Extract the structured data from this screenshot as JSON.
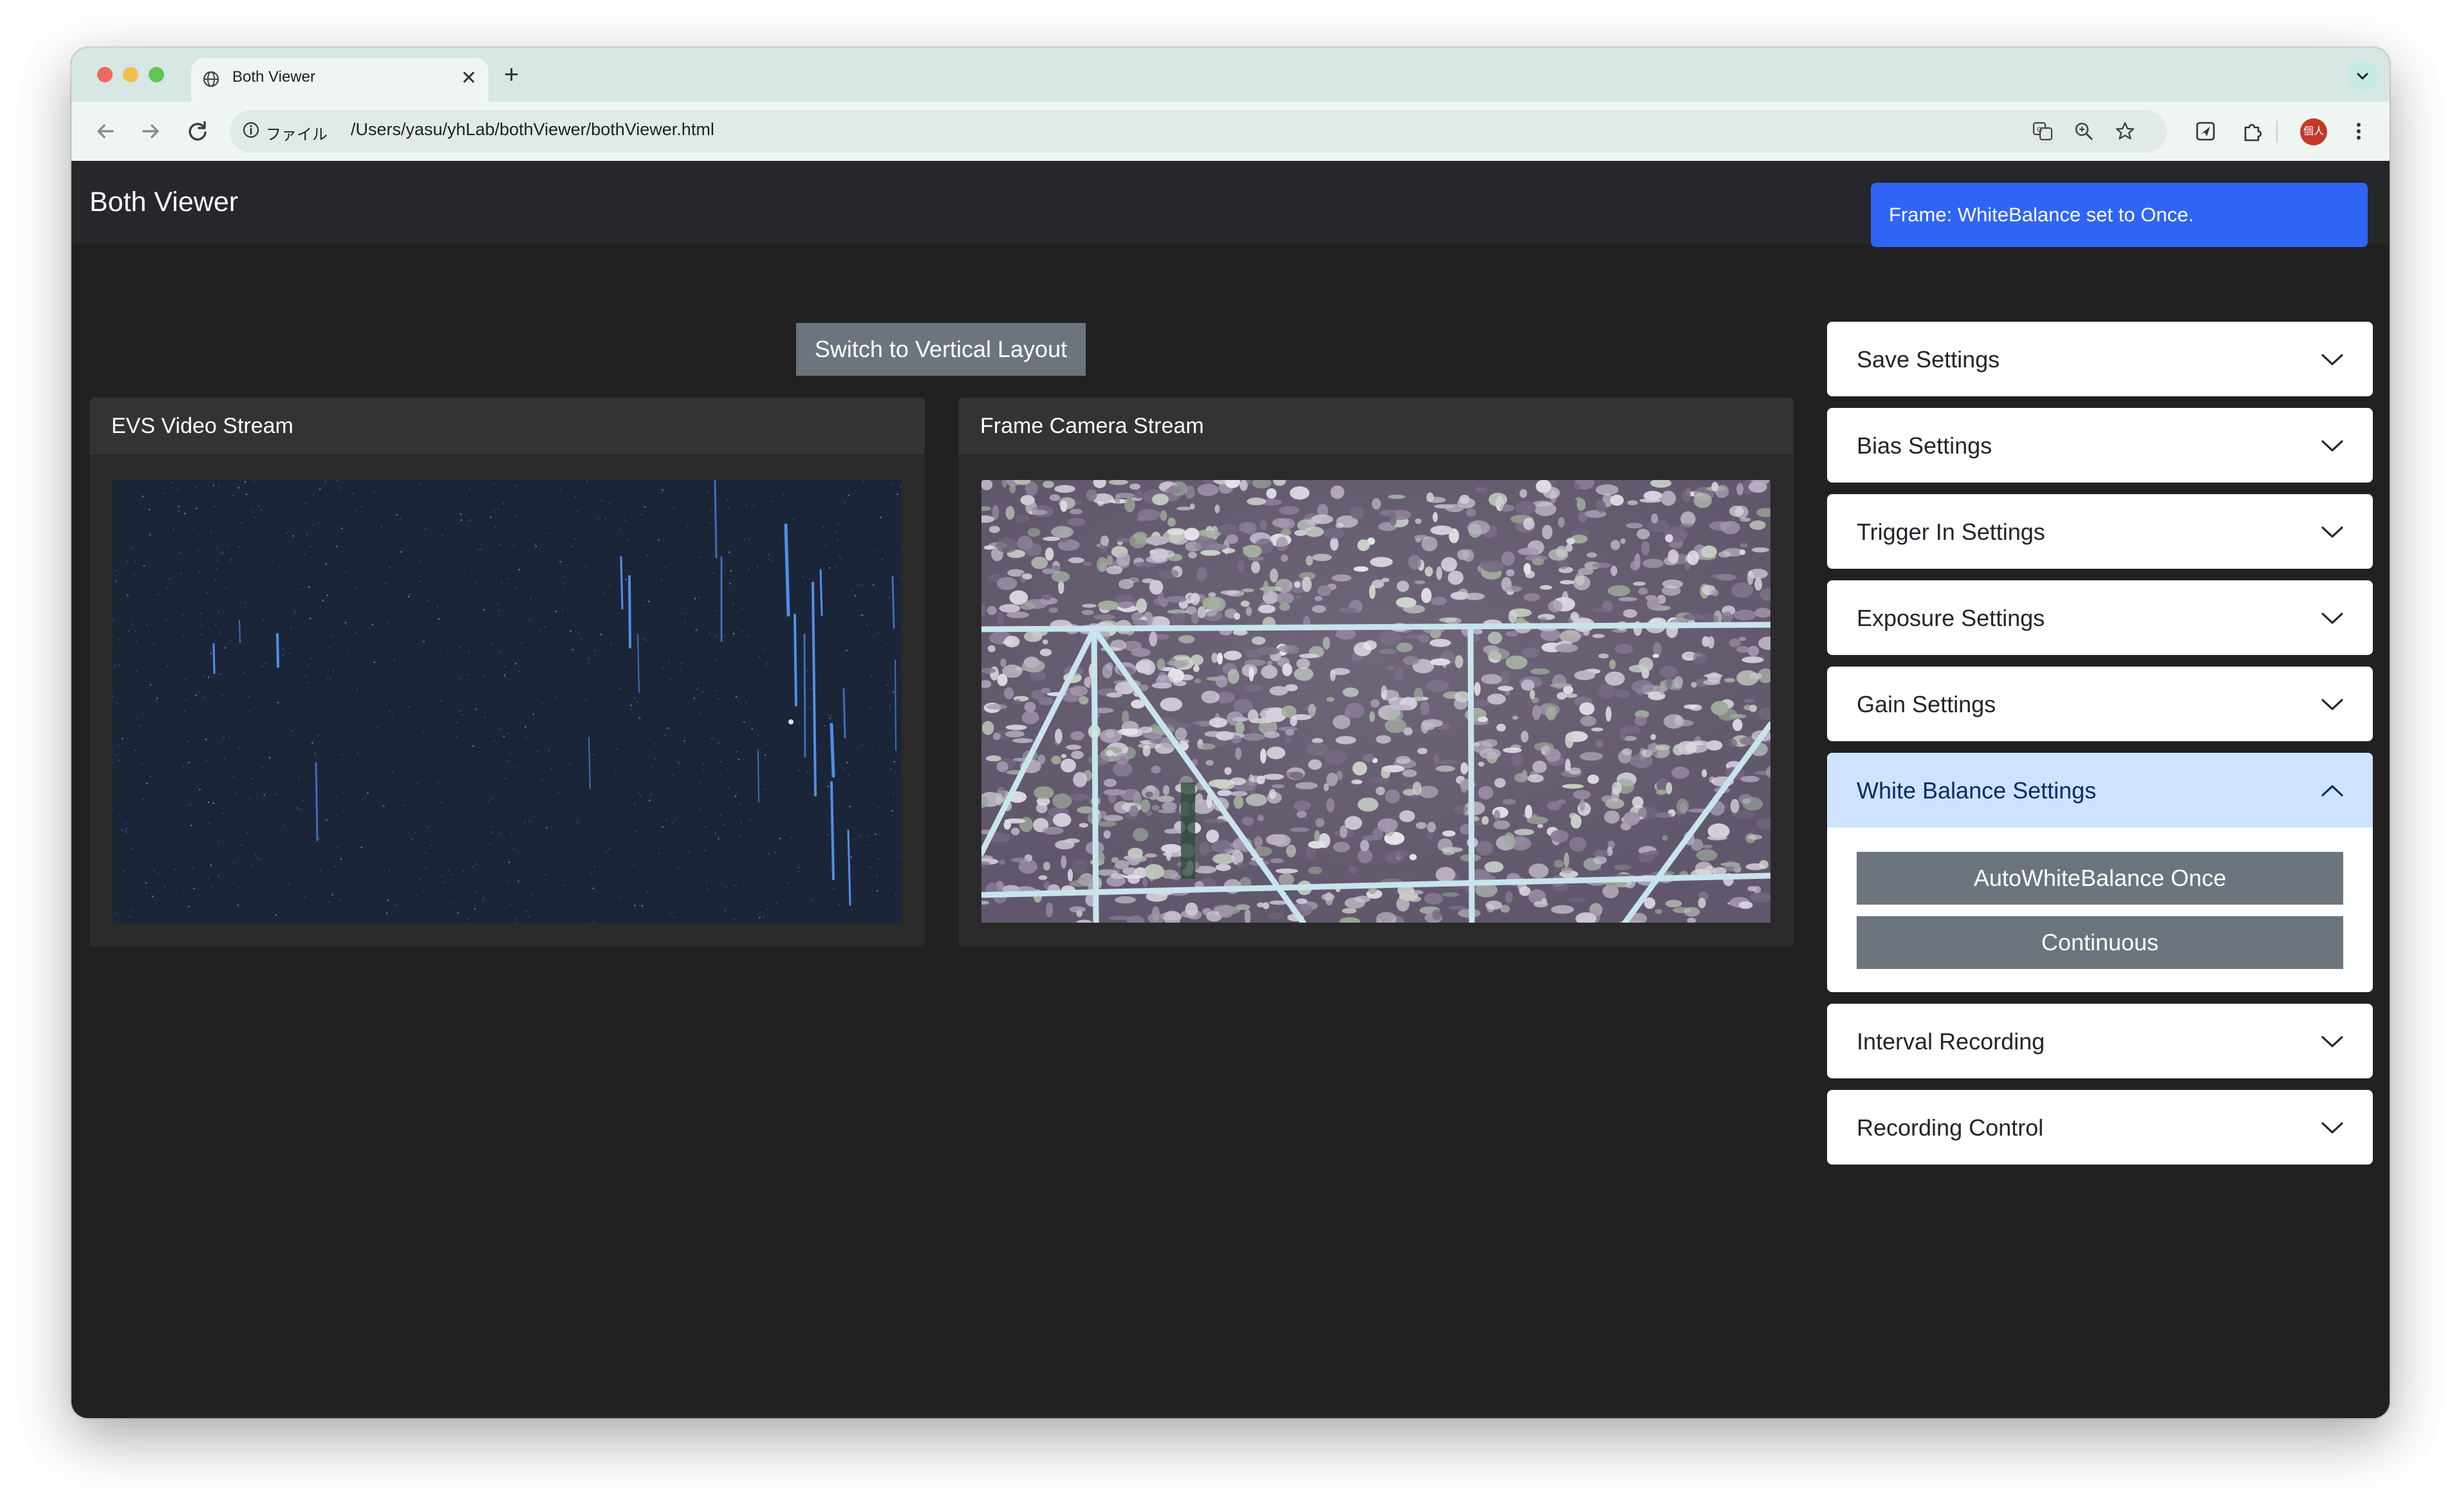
{
  "browser": {
    "tab_title": "Both Viewer",
    "tab_close": "✕",
    "new_tab": "+",
    "file_chip": "ファイル",
    "url": "/Users/yasu/yhLab/bothViewer/bothViewer.html",
    "profile_badge": "個人",
    "traffic_colors": [
      "#ed6a5e",
      "#f5bf4f",
      "#61c554"
    ]
  },
  "app": {
    "title": "Both Viewer",
    "toast": "Frame: WhiteBalance set to Once.",
    "switch_layout_label": "Switch to Vertical Layout",
    "evs_title": "EVS Video Stream",
    "frame_title": "Frame Camera Stream"
  },
  "accordion": {
    "save": "Save Settings",
    "bias": "Bias Settings",
    "trigger_in": "Trigger In Settings",
    "exposure": "Exposure Settings",
    "gain": "Gain Settings",
    "white_balance": "White Balance Settings",
    "white_balance_once": "AutoWhiteBalance Once",
    "white_balance_continuous": "Continuous",
    "interval_recording": "Interval Recording",
    "recording_control": "Recording Control"
  },
  "colors": {
    "toast_bg": "#2f64f5",
    "app_bg": "#212121",
    "open_section_bg": "#cfe2ff",
    "button_gray": "#6c757d"
  },
  "icons": [
    "globe-icon",
    "close-icon",
    "plus-icon",
    "chevron-down-icon",
    "back-arrow-icon",
    "forward-arrow-icon",
    "reload-icon",
    "info-icon",
    "translate-icon",
    "zoom-icon",
    "star-icon",
    "send-icon",
    "extensions-icon",
    "profile-avatar",
    "menu-dots-icon",
    "chevron-up-icon"
  ]
}
